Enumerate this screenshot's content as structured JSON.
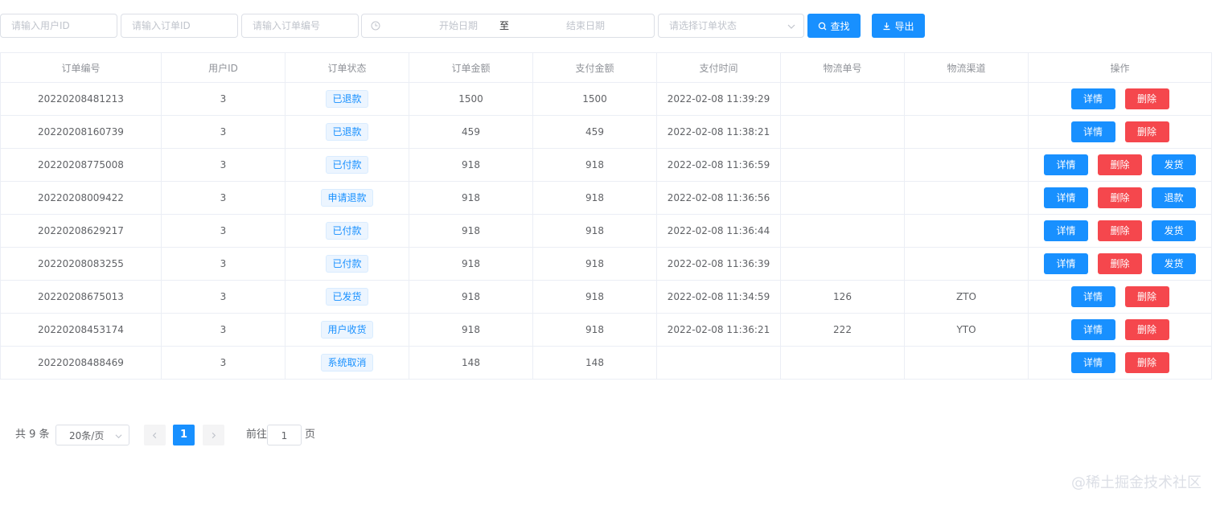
{
  "filters": {
    "user_id_placeholder": "请输入用户ID",
    "order_id_placeholder": "请输入订单ID",
    "order_no_placeholder": "请输入订单编号",
    "start_date_placeholder": "开始日期",
    "range_separator": "至",
    "end_date_placeholder": "结束日期",
    "status_placeholder": "请选择订单状态",
    "search_label": "查找",
    "export_label": "导出"
  },
  "table": {
    "headers": [
      "订单编号",
      "用户ID",
      "订单状态",
      "订单金额",
      "支付金额",
      "支付时间",
      "物流单号",
      "物流渠道",
      "操作"
    ],
    "rows": [
      {
        "order_no": "20220208481213",
        "user_id": "3",
        "status": "已退款",
        "amount": "1500",
        "paid": "1500",
        "pay_time": "2022-02-08 11:39:29",
        "tracking": "",
        "channel": "",
        "actions": [
          "详情",
          "删除"
        ]
      },
      {
        "order_no": "20220208160739",
        "user_id": "3",
        "status": "已退款",
        "amount": "459",
        "paid": "459",
        "pay_time": "2022-02-08 11:38:21",
        "tracking": "",
        "channel": "",
        "actions": [
          "详情",
          "删除"
        ]
      },
      {
        "order_no": "20220208775008",
        "user_id": "3",
        "status": "已付款",
        "amount": "918",
        "paid": "918",
        "pay_time": "2022-02-08 11:36:59",
        "tracking": "",
        "channel": "",
        "actions": [
          "详情",
          "删除",
          "发货"
        ]
      },
      {
        "order_no": "20220208009422",
        "user_id": "3",
        "status": "申请退款",
        "amount": "918",
        "paid": "918",
        "pay_time": "2022-02-08 11:36:56",
        "tracking": "",
        "channel": "",
        "actions": [
          "详情",
          "删除",
          "退款"
        ]
      },
      {
        "order_no": "20220208629217",
        "user_id": "3",
        "status": "已付款",
        "amount": "918",
        "paid": "918",
        "pay_time": "2022-02-08 11:36:44",
        "tracking": "",
        "channel": "",
        "actions": [
          "详情",
          "删除",
          "发货"
        ]
      },
      {
        "order_no": "20220208083255",
        "user_id": "3",
        "status": "已付款",
        "amount": "918",
        "paid": "918",
        "pay_time": "2022-02-08 11:36:39",
        "tracking": "",
        "channel": "",
        "actions": [
          "详情",
          "删除",
          "发货"
        ]
      },
      {
        "order_no": "20220208675013",
        "user_id": "3",
        "status": "已发货",
        "amount": "918",
        "paid": "918",
        "pay_time": "2022-02-08 11:34:59",
        "tracking": "126",
        "channel": "ZTO",
        "actions": [
          "详情",
          "删除"
        ]
      },
      {
        "order_no": "20220208453174",
        "user_id": "3",
        "status": "用户收货",
        "amount": "918",
        "paid": "918",
        "pay_time": "2022-02-08 11:36:21",
        "tracking": "222",
        "channel": "YTO",
        "actions": [
          "详情",
          "删除"
        ]
      },
      {
        "order_no": "20220208488469",
        "user_id": "3",
        "status": "系统取消",
        "amount": "148",
        "paid": "148",
        "pay_time": "",
        "tracking": "",
        "channel": "",
        "actions": [
          "详情",
          "删除"
        ]
      }
    ]
  },
  "pagination": {
    "total_label": "共 9 条",
    "page_size": "20条/页",
    "current_page": "1",
    "goto_label": "前往",
    "goto_value": "1",
    "page_unit": "页"
  },
  "watermark": "@稀土掘金技术社区",
  "colors": {
    "primary": "#1890ff",
    "danger": "#f5474d",
    "border": "#dcdfe6"
  },
  "icons": [
    "clock-icon",
    "chevron-down-icon",
    "search-icon",
    "download-icon",
    "chevron-left-icon",
    "chevron-right-icon"
  ]
}
